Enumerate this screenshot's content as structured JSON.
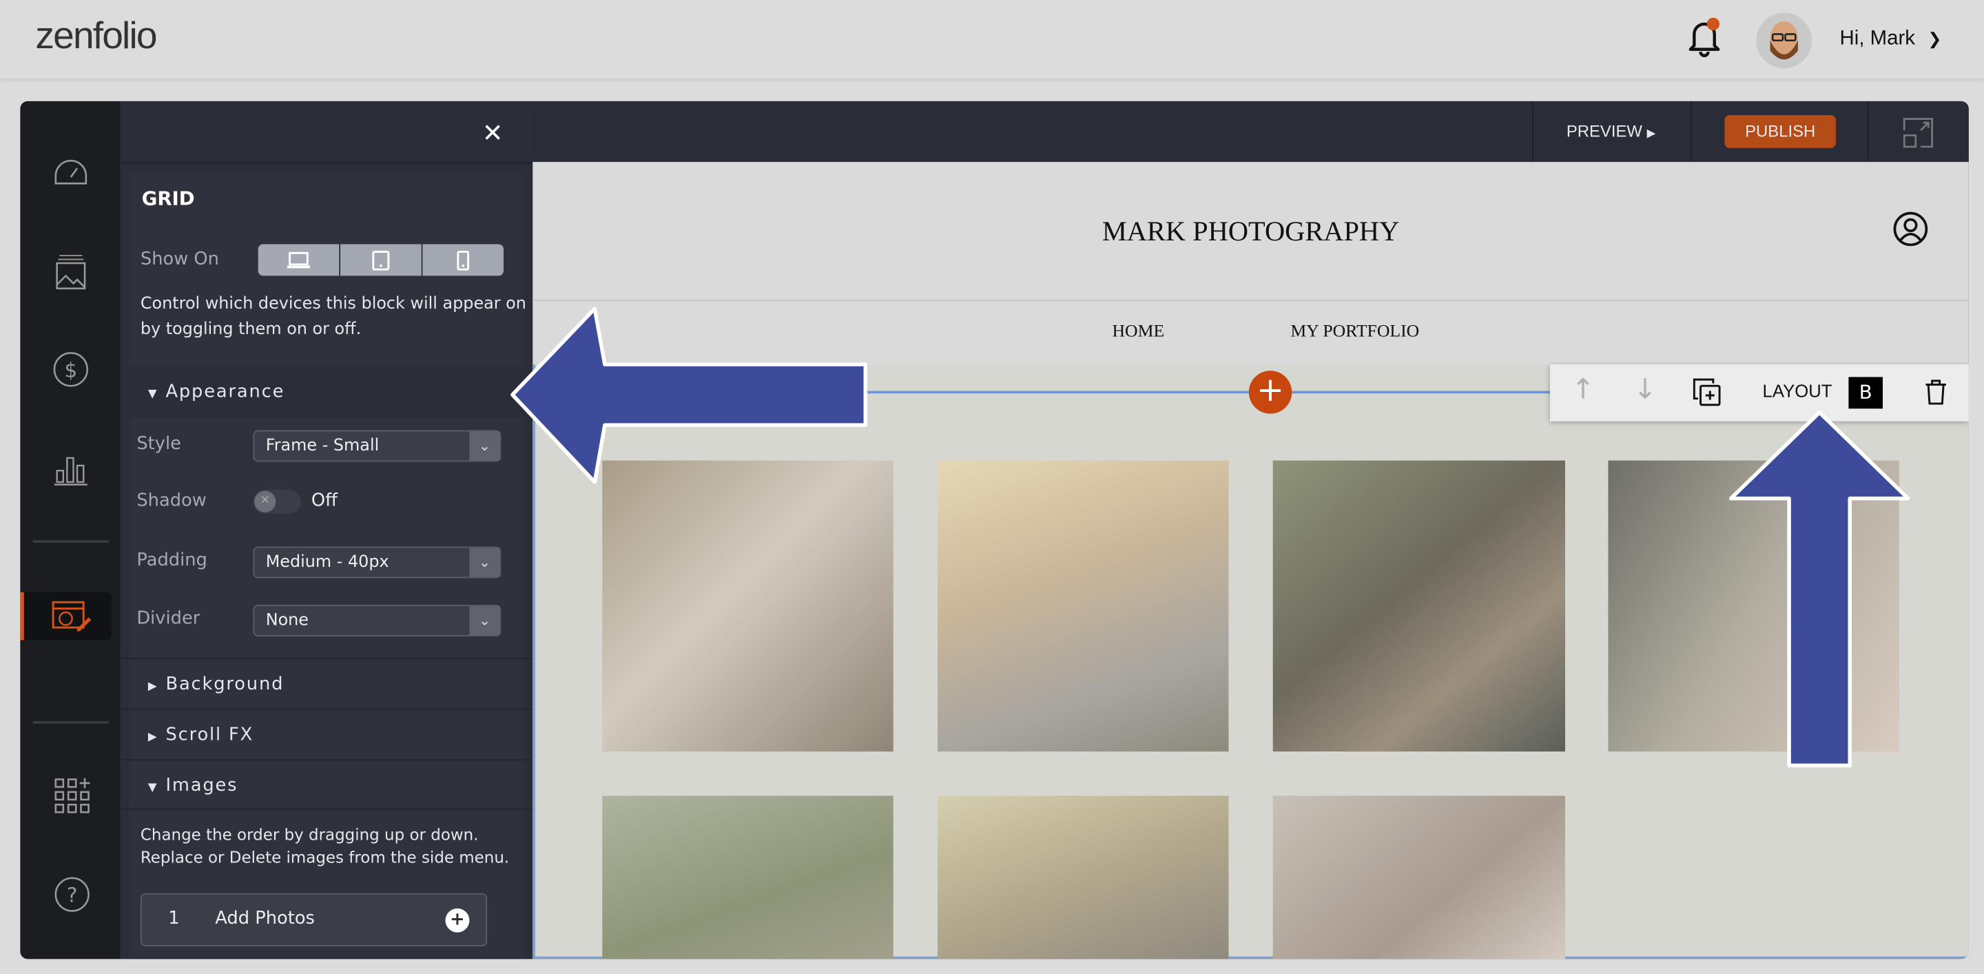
{
  "header": {
    "logo": "zenfolio",
    "greeting": "Hi, Mark",
    "notification_dot_color": "#d1541a"
  },
  "toolbar": {
    "preview": "PREVIEW",
    "publish": "PUBLISH",
    "publish_color": "#b54c17"
  },
  "panel": {
    "title": "GRID",
    "show_on_label": "Show On",
    "show_on_help": "Control which devices this block will appear on by toggling them on or off.",
    "appearance": "Appearance",
    "style_label": "Style",
    "style_value": "Frame - Small",
    "shadow_label": "Shadow",
    "shadow_value": "Off",
    "padding_label": "Padding",
    "padding_value": "Medium - 40px",
    "divider_label": "Divider",
    "divider_value": "None",
    "background": "Background",
    "scroll_fx": "Scroll FX",
    "images": "Images",
    "images_help": "Change the order by dragging up or down. Replace or Delete images from the side menu.",
    "add_count": "1",
    "add_photos": "Add Photos"
  },
  "site": {
    "title": "MARK PHOTOGRAPHY",
    "nav": [
      "HOME",
      "MY PORTFOLIO"
    ]
  },
  "block_toolbar": {
    "layout": "LAYOUT",
    "layout_variant": "B"
  },
  "annotation_color": "#3d4b9a"
}
